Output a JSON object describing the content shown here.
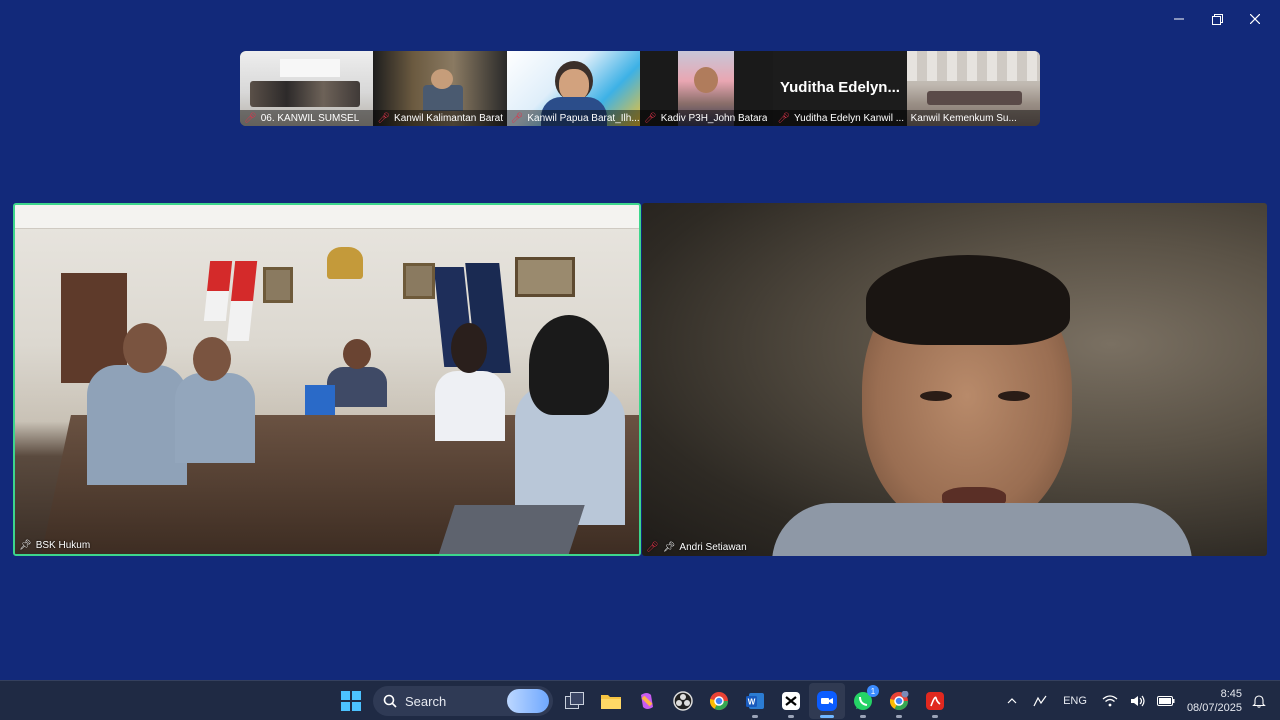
{
  "window": {
    "minimize_icon": "minimize-icon",
    "restore_icon": "restore-icon",
    "close_icon": "close-icon"
  },
  "thumbnails": [
    {
      "label": "06. KANWIL SUMSEL",
      "muted": true
    },
    {
      "label": "Kanwil Kalimantan Barat",
      "muted": true
    },
    {
      "label": "Kanwil Papua Barat_Ilh...",
      "muted": true
    },
    {
      "label": "Kadiv P3H_John Batara",
      "muted": true
    },
    {
      "label": "Yuditha Edelyn Kanwil ...",
      "muted": true,
      "display_name": "Yuditha  Edelyn..."
    },
    {
      "label": "Kanwil Kemenkum Su...",
      "muted": false
    }
  ],
  "main": {
    "left": {
      "name": "BSK Hukum",
      "pinned": true,
      "muted": false,
      "speaking": true
    },
    "right": {
      "name": "Andri Setiawan",
      "pinned": true,
      "muted": true
    }
  },
  "taskbar": {
    "search_label": "Search",
    "whatsapp_badge": "1",
    "tray": {
      "language": "ENG",
      "time": "8:45",
      "date": "08/07/2025"
    }
  },
  "colors": {
    "background": "#12297a",
    "active_speaker_border": "#3dd68c",
    "muted_icon": "#e0334a",
    "taskbar": "#1f2a44"
  }
}
